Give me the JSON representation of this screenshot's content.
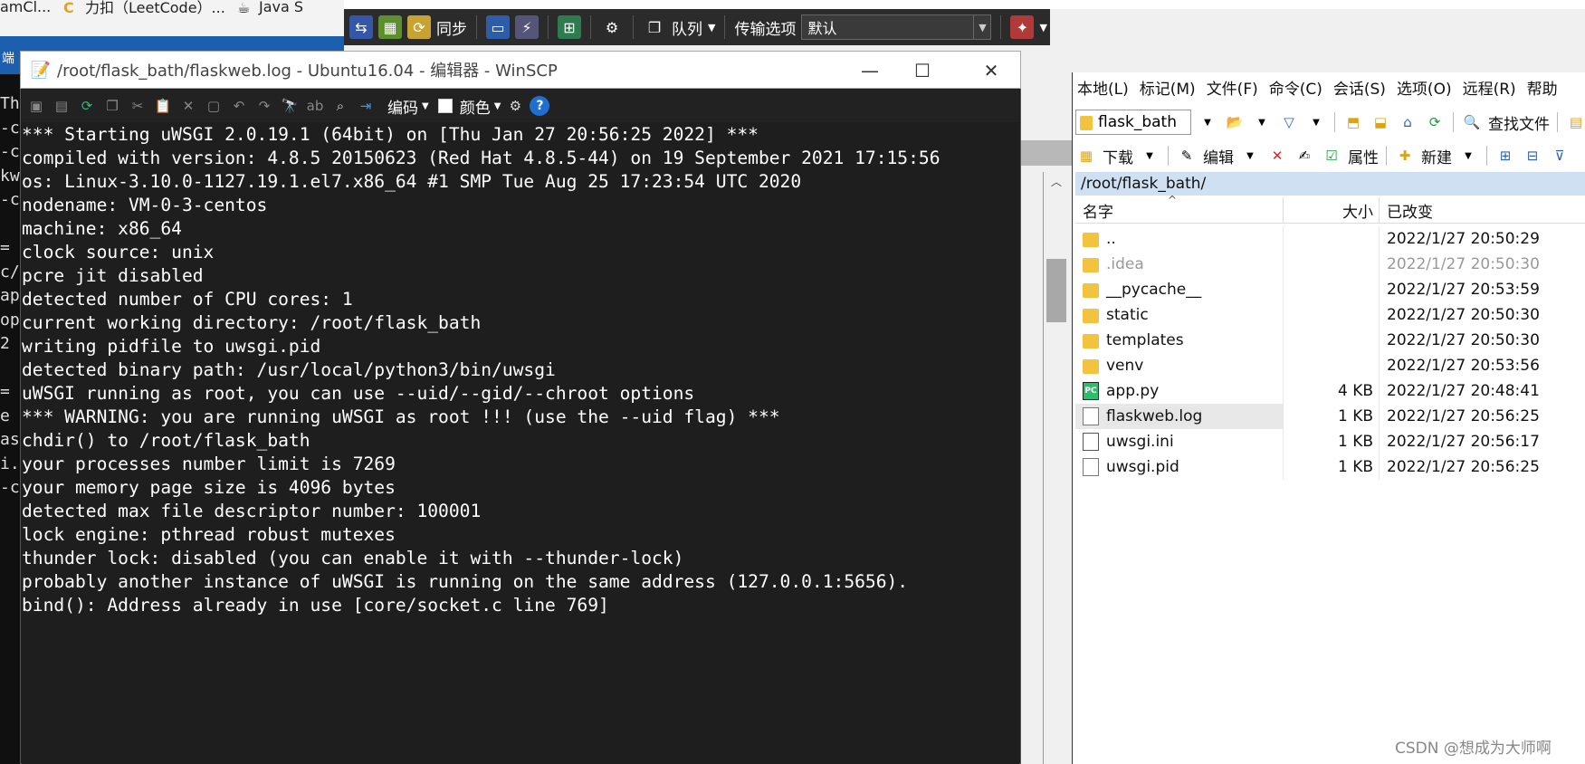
{
  "browser_tabs": [
    {
      "label": "amCl..."
    },
    {
      "label": "力扣（LeetCode）..."
    },
    {
      "label": "Java S"
    }
  ],
  "left_panel_fragments": [
    "端",
    "Th",
    "-c",
    "-c",
    "kw",
    "-c",
    "",
    "=",
    "c/",
    "ap",
    "op",
    "2",
    "",
    "=",
    "e",
    "as",
    "i.",
    "-c"
  ],
  "main_toolbar": {
    "sync_label": "同步",
    "queue_label": "队列",
    "transfer_options_label": "传输选项",
    "transfer_profile_value": "默认"
  },
  "editor": {
    "title": "/root/flask_bath/flaskweb.log - Ubuntu16.04 - 编辑器 - WinSCP",
    "encoding_label": "编码",
    "color_label": "颜色",
    "lines": [
      "*** Starting uWSGI 2.0.19.1 (64bit) on [Thu Jan 27 20:56:25 2022] ***",
      "compiled with version: 4.8.5 20150623 (Red Hat 4.8.5-44) on 19 September 2021 17:15:56",
      "os: Linux-3.10.0-1127.19.1.el7.x86_64 #1 SMP Tue Aug 25 17:23:54 UTC 2020",
      "nodename: VM-0-3-centos",
      "machine: x86_64",
      "clock source: unix",
      "pcre jit disabled",
      "detected number of CPU cores: 1",
      "current working directory: /root/flask_bath",
      "writing pidfile to uwsgi.pid",
      "detected binary path: /usr/local/python3/bin/uwsgi",
      "uWSGI running as root, you can use --uid/--gid/--chroot options",
      "*** WARNING: you are running uWSGI as root !!! (use the --uid flag) ***",
      "chdir() to /root/flask_bath",
      "your processes number limit is 7269",
      "your memory page size is 4096 bytes",
      "detected max file descriptor number: 100001",
      "lock engine: pthread robust mutexes",
      "thunder lock: disabled (you can enable it with --thunder-lock)",
      "probably another instance of uWSGI is running on the same address (127.0.0.1:5656).",
      "bind(): Address already in use [core/socket.c line 769]"
    ]
  },
  "remote_panel": {
    "menu": [
      "本地(L)",
      "标记(M)",
      "文件(F)",
      "命令(C)",
      "会话(S)",
      "选项(O)",
      "远程(R)",
      "帮助"
    ],
    "path_combo_value": "flask_bath",
    "find_files_label": "查找文件",
    "download_label": "下载",
    "edit_label": "编辑",
    "properties_label": "属性",
    "new_label": "新建",
    "current_path": "/root/flask_bath/",
    "columns": {
      "name": "名字",
      "size": "大小",
      "modified": "已改变"
    },
    "files": [
      {
        "name": "..",
        "size": "",
        "modified": "2022/1/27 20:50:29",
        "type": "parent"
      },
      {
        "name": ".idea",
        "size": "",
        "modified": "2022/1/27 20:50:30",
        "type": "folder",
        "hidden": true
      },
      {
        "name": "__pycache__",
        "size": "",
        "modified": "2022/1/27 20:53:59",
        "type": "folder"
      },
      {
        "name": "static",
        "size": "",
        "modified": "2022/1/27 20:50:30",
        "type": "folder"
      },
      {
        "name": "templates",
        "size": "",
        "modified": "2022/1/27 20:50:30",
        "type": "folder"
      },
      {
        "name": "venv",
        "size": "",
        "modified": "2022/1/27 20:53:56",
        "type": "folder"
      },
      {
        "name": "app.py",
        "size": "4 KB",
        "modified": "2022/1/27 20:48:41",
        "type": "python"
      },
      {
        "name": "flaskweb.log",
        "size": "1 KB",
        "modified": "2022/1/27 20:56:25",
        "type": "file",
        "selected": true
      },
      {
        "name": "uwsgi.ini",
        "size": "1 KB",
        "modified": "2022/1/27 20:56:17",
        "type": "config"
      },
      {
        "name": "uwsgi.pid",
        "size": "1 KB",
        "modified": "2022/1/27 20:56:25",
        "type": "file"
      }
    ]
  },
  "watermark": "CSDN @想成为大师啊",
  "icons": {
    "folder_color": "#f2c33f",
    "help_color": "#1f6fd1",
    "path_bar_color": "#cfe0f3"
  }
}
